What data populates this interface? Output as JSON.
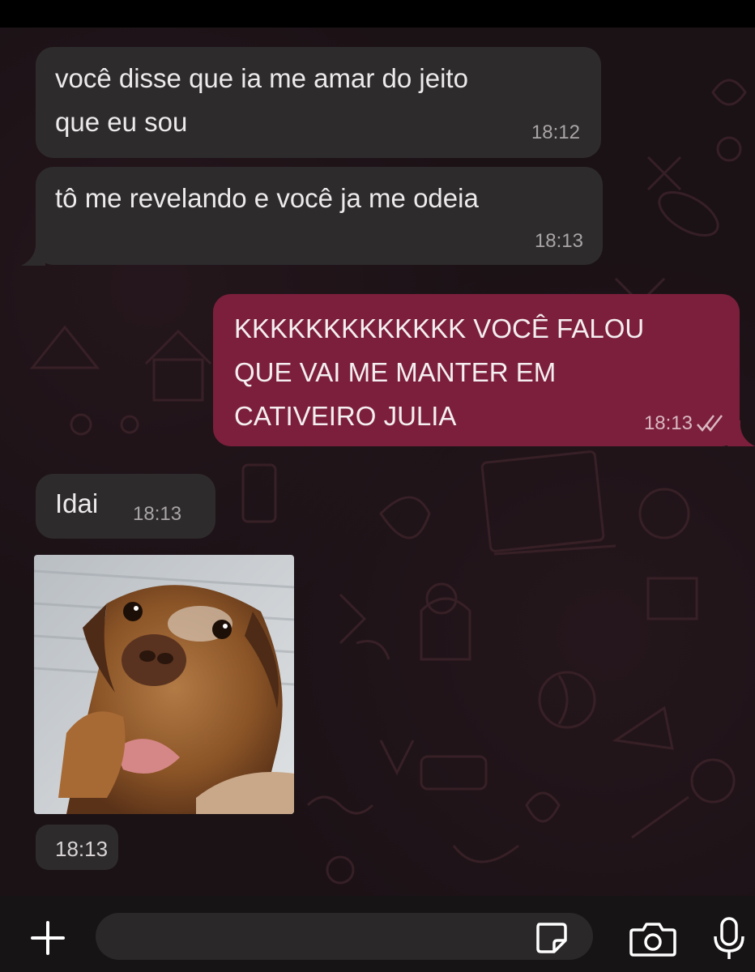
{
  "messages": [
    {
      "id": "m1",
      "direction": "incoming",
      "text_lines": [
        "você disse que ia me amar do jeito",
        "que eu sou"
      ],
      "time": "18:12"
    },
    {
      "id": "m2",
      "direction": "incoming",
      "text_lines": [
        "tô me revelando e você ja me odeia"
      ],
      "time": "18:13"
    },
    {
      "id": "m3",
      "direction": "outgoing",
      "text_lines": [
        "KKKKKKKKKKKKK VOCÊ FALOU",
        "QUE VAI ME MANTER EM",
        "CATIVEIRO JULIA"
      ],
      "time": "18:13",
      "status": "read"
    },
    {
      "id": "m4",
      "direction": "incoming",
      "text_lines": [
        "Idai"
      ],
      "time": "18:13"
    },
    {
      "id": "m5",
      "direction": "incoming",
      "type": "image",
      "image_subject": "dog photo",
      "time": "18:13"
    }
  ],
  "input_bar": {
    "add_icon": "plus-icon",
    "sticker_icon": "sticker-icon",
    "camera_icon": "camera-icon",
    "mic_icon": "microphone-icon",
    "placeholder": ""
  },
  "colors": {
    "incoming_bubble": "#2e2b2d",
    "outgoing_bubble": "#7c1f3c",
    "chat_background": "#1b1216",
    "input_bar": "#161415"
  }
}
